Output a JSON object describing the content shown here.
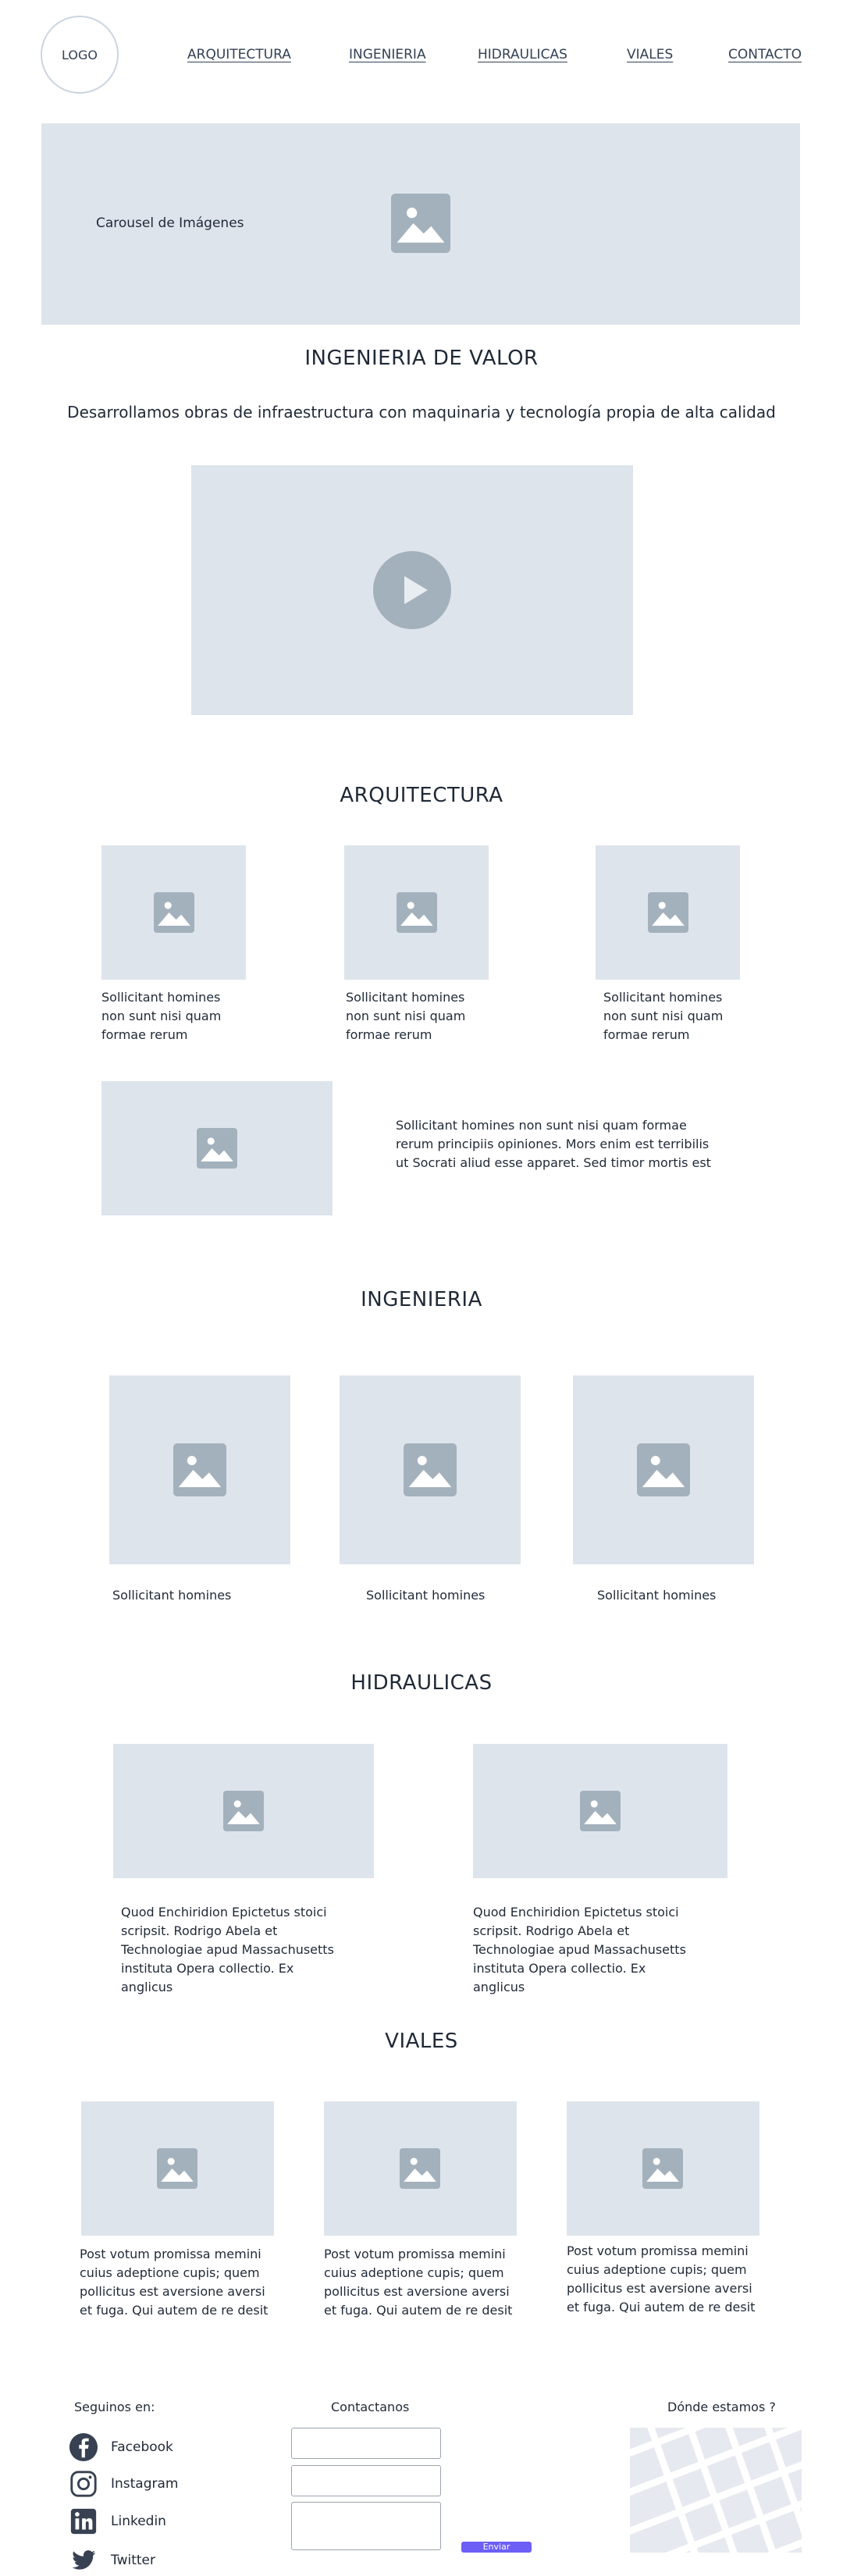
{
  "header": {
    "logo": "LOGO",
    "nav": [
      "ARQUITECTURA",
      "INGENIERIA",
      "HIDRAULICAS",
      "VIALES",
      "CONTACTO"
    ]
  },
  "hero": {
    "carousel_label": "Carousel de Imágenes"
  },
  "intro": {
    "title": "INGENIERIA DE VALOR",
    "subtitle": "Desarrollamos obras de infraestructura con maquinaria y tecnología propia de alta calidad"
  },
  "arquitectura": {
    "title": "ARQUITECTURA",
    "cards": [
      "Sollicitant homines non sunt nisi quam formae rerum",
      "Sollicitant homines non sunt nisi quam formae rerum",
      "Sollicitant homines non sunt nisi quam formae rerum"
    ],
    "feature_text": "Sollicitant homines non sunt nisi quam formae rerum principiis opiniones. Mors enim est terribilis ut Socrati aliud esse apparet. Sed timor mortis est"
  },
  "ingenieria": {
    "title": "INGENIERIA",
    "cards": [
      "Sollicitant homines",
      "Sollicitant homines",
      "Sollicitant homines"
    ]
  },
  "hidraulicas": {
    "title": "HIDRAULICAS",
    "cards": [
      "Quod Enchiridion Epictetus stoici scripsit. Rodrigo Abela et Technologiae apud Massachusetts instituta Opera collectio. Ex anglicus",
      "Quod Enchiridion Epictetus stoici scripsit. Rodrigo Abela et Technologiae apud Massachusetts instituta Opera collectio. Ex anglicus"
    ]
  },
  "viales": {
    "title": "VIALES",
    "cards": [
      "Post votum promissa memini cuius adeptione cupis; quem pollicitus est aversione aversi et fuga. Qui autem de re desit",
      "Post votum promissa memini cuius adeptione cupis; quem pollicitus est aversione aversi et fuga. Qui autem de re desit",
      "Post votum promissa memini cuius adeptione cupis; quem pollicitus est aversione aversi et fuga. Qui autem de re desit"
    ]
  },
  "footer": {
    "follow_label": "Seguinos en:",
    "social": [
      "Facebook",
      "Instagram",
      "Linkedin",
      "Twitter"
    ],
    "contact_label": "Contactanos",
    "submit_label": "Enviar",
    "location_label": "Dónde estamos ?"
  },
  "colors": {
    "placeholder": "#dee4ec",
    "icon": "#a3b1bd",
    "accent": "#6d5ef6",
    "text": "#1f2937"
  }
}
